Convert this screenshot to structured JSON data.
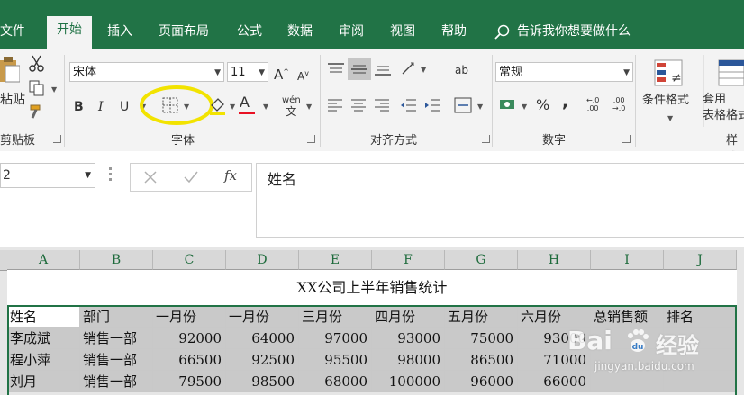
{
  "tabs": [
    "文件",
    "开始",
    "插入",
    "页面布局",
    "公式",
    "数据",
    "审阅",
    "视图",
    "帮助"
  ],
  "tell_me": "告诉我你想要做什么",
  "clipboard": {
    "paste_label": "粘贴",
    "group_label": "剪贴板"
  },
  "font": {
    "name": "宋体",
    "size": "11",
    "bold": "B",
    "italic": "I",
    "underline": "U",
    "font_color_glyph": "A",
    "phonetic_glyph": "wén",
    "increase": "A",
    "decrease": "A",
    "group_label": "字体"
  },
  "alignment": {
    "group_label": "对齐方式",
    "wrap": "ab"
  },
  "number": {
    "format": "常规",
    "group_label": "数字",
    "percent": "%",
    "comma": ",",
    "inc_decimal": "←.0\n.00",
    "dec_decimal": ".00\n→.0"
  },
  "styles": {
    "conditional": "条件格式",
    "table_format": "套用\n表格格式",
    "group_label": "样式"
  },
  "formula_bar": {
    "namebox": "2",
    "fx": "fx",
    "content": "姓名"
  },
  "colors": {
    "accent": "#217346",
    "highlight": "#f2e300",
    "font_color": "#e81123"
  },
  "columns": [
    "A",
    "B",
    "C",
    "D",
    "E",
    "F",
    "G",
    "H",
    "I",
    "J"
  ],
  "sheet": {
    "title": "XX公司上半年销售统计",
    "headers": [
      "姓名",
      "部门",
      "一月份",
      "一月份",
      "三月份",
      "四月份",
      "五月份",
      "六月份",
      "总销售额",
      "排名"
    ],
    "rows": [
      [
        "李成斌",
        "销售一部",
        "92000",
        "64000",
        "97000",
        "93000",
        "75000",
        "93000",
        "",
        ""
      ],
      [
        "程小萍",
        "销售一部",
        "66500",
        "92500",
        "95500",
        "98000",
        "86500",
        "71000",
        "",
        ""
      ],
      [
        "刘月",
        "销售一部",
        "79500",
        "98500",
        "68000",
        "100000",
        "96000",
        "66000",
        "",
        ""
      ]
    ]
  },
  "watermark": {
    "brand": "Bai",
    "brand2": "经验",
    "url": "jingyan.baidu.com"
  }
}
